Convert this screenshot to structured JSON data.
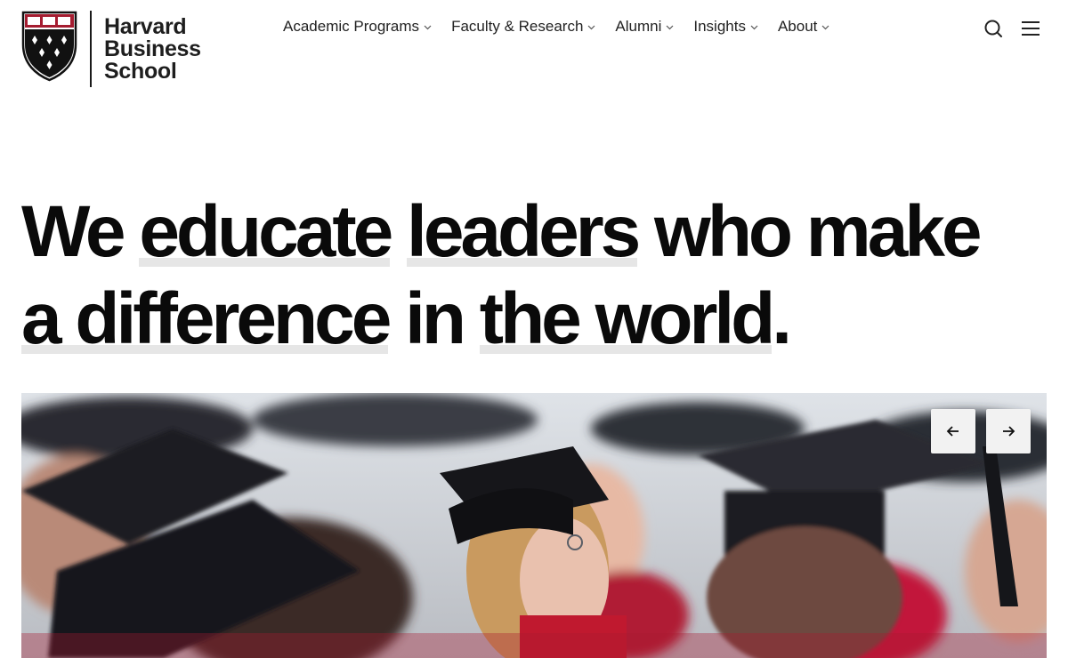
{
  "brand": {
    "wordmark_line1": "Harvard",
    "wordmark_line2": "Business",
    "wordmark_line3": "School",
    "shield_colors": {
      "crimson": "#a51c30",
      "black": "#111111"
    }
  },
  "nav": {
    "items": [
      {
        "label": "Academic Programs",
        "icon": "chevron-down-icon"
      },
      {
        "label": "Faculty & Research",
        "icon": "chevron-down-icon"
      },
      {
        "label": "Alumni",
        "icon": "chevron-down-icon"
      },
      {
        "label": "Insights",
        "icon": "chevron-down-icon"
      },
      {
        "label": "About",
        "icon": "chevron-down-icon"
      }
    ],
    "search_icon": "search-icon",
    "menu_icon": "hamburger-menu-icon"
  },
  "hero": {
    "headline": {
      "w1": "We",
      "w2": "educate",
      "w3": "leaders",
      "w4": "who",
      "w5": "make",
      "w6": "a",
      "w7": "difference",
      "w8": "in",
      "w9": "the",
      "w10": "world",
      "period": "."
    },
    "carousel": {
      "prev_icon": "arrow-left-icon",
      "next_icon": "arrow-right-icon"
    }
  }
}
